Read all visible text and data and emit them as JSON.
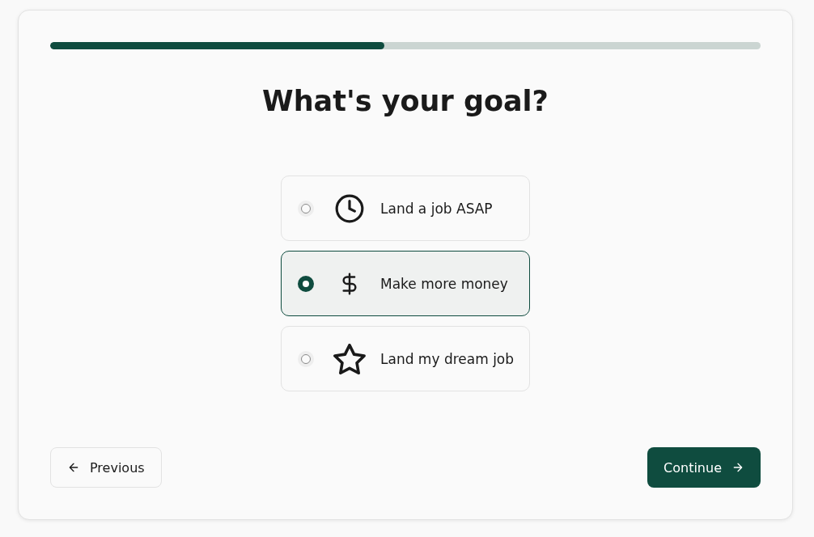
{
  "progress": {
    "level": 0.47
  },
  "title": "What's your goal?",
  "options": [
    {
      "label": "Land a job ASAP",
      "kind": "clock",
      "selected": false
    },
    {
      "label": "Make more money",
      "kind": "dollar",
      "selected": true
    },
    {
      "label": "Land my dream job",
      "kind": "star",
      "selected": false
    }
  ],
  "buttons": {
    "previous": "Previous",
    "continue": "Continue"
  }
}
